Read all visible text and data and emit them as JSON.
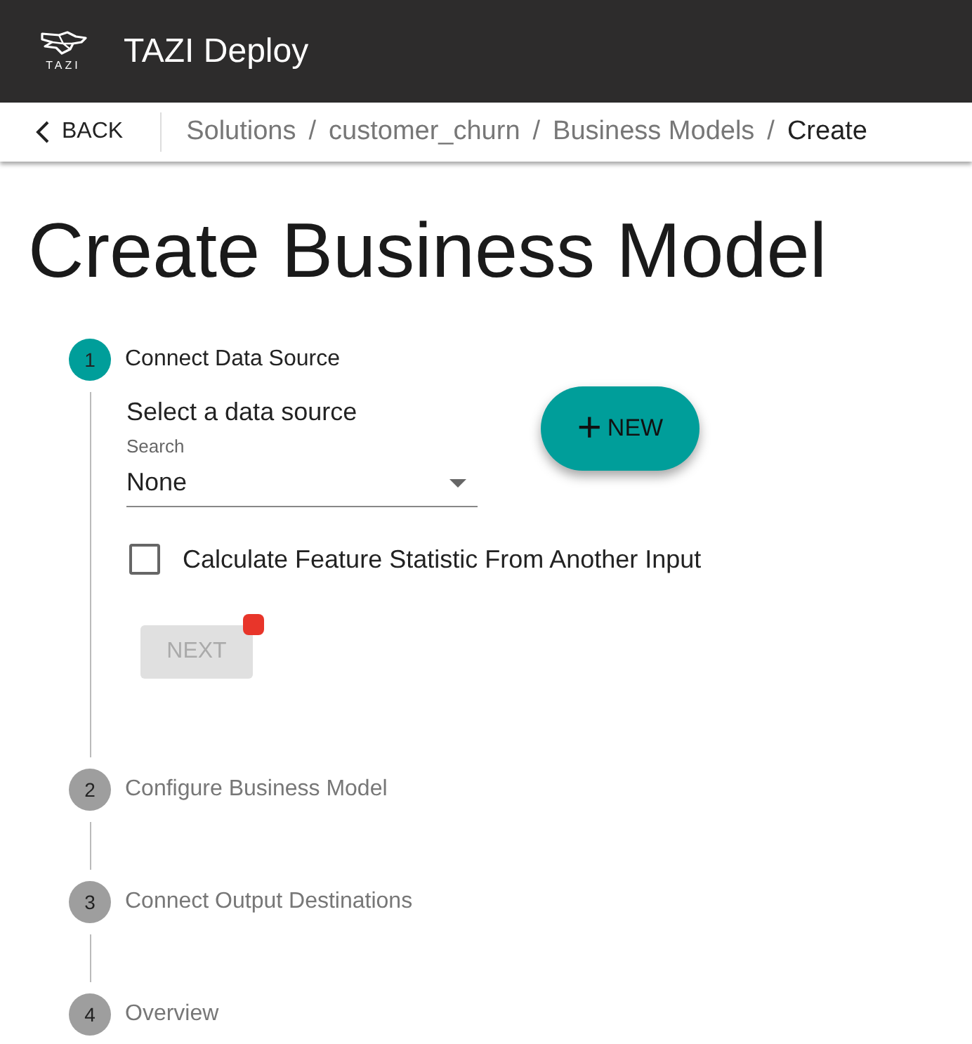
{
  "app_bar": {
    "logo_text": "TAZI",
    "title": "TAZI Deploy"
  },
  "nav_bar": {
    "back": "BACK",
    "breadcrumbs": [
      {
        "label": "Solutions",
        "current": false
      },
      {
        "label": "customer_churn",
        "current": false
      },
      {
        "label": "Business Models",
        "current": false
      },
      {
        "label": "Create",
        "current": true
      }
    ],
    "separators": [
      "/",
      "/",
      "/"
    ]
  },
  "page_title": "Create Business Model",
  "steps": [
    {
      "number": "1",
      "label": "Connect Data Source",
      "active": true
    },
    {
      "number": "2",
      "label": "Configure Business Model",
      "active": false
    },
    {
      "number": "3",
      "label": "Connect Output Destinations",
      "active": false
    },
    {
      "number": "4",
      "label": "Overview",
      "active": false
    }
  ],
  "step_form": {
    "heading": "Select a data source",
    "select": {
      "label": "Search",
      "value": "None"
    },
    "new_button": {
      "icon": "+",
      "label": "NEW"
    },
    "checkbox": {
      "label": "Calculate Feature Statistic From Another Input",
      "checked": false
    },
    "next_button": {
      "label": "NEXT",
      "disabled": true,
      "flagged": true
    }
  }
}
